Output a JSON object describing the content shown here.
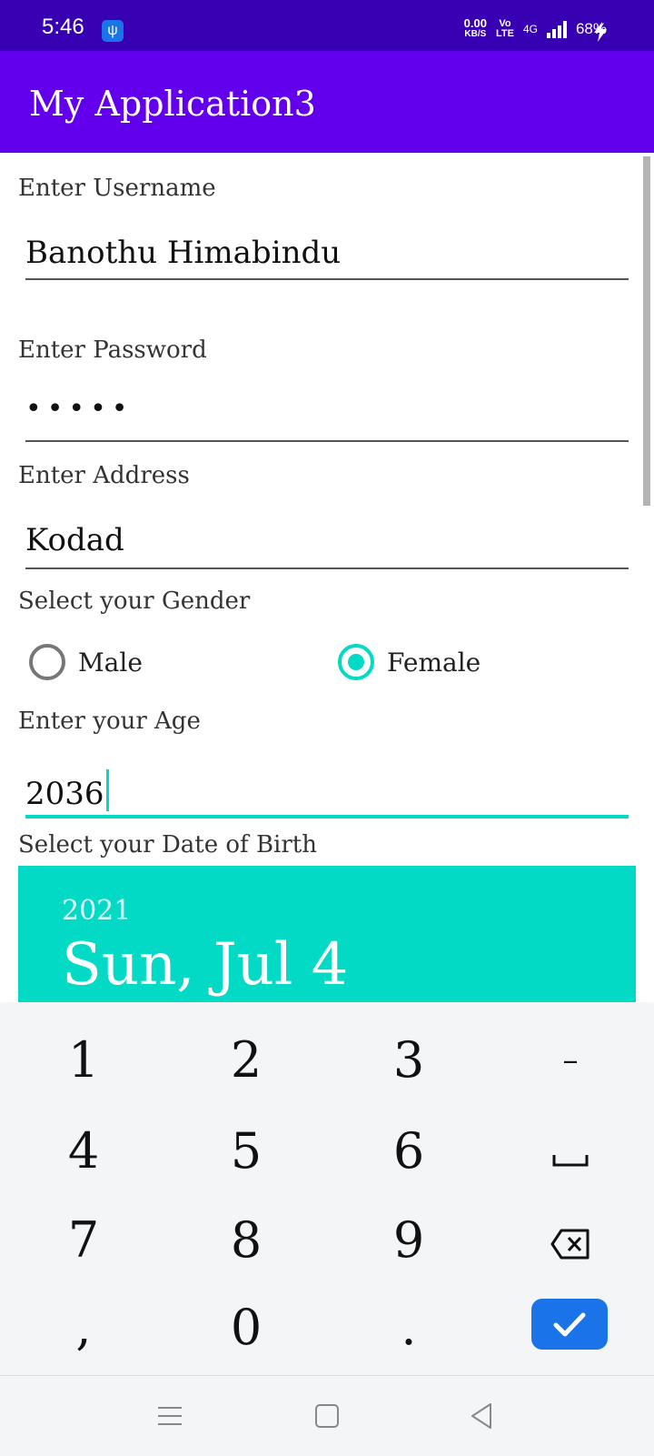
{
  "status_bar": {
    "time": "5:46",
    "speed_value": "0.00",
    "speed_unit": "KB/S",
    "volte_top": "Vo",
    "volte_bottom": "LTE",
    "network": "4G",
    "battery": "68%",
    "icons": [
      "usb-icon",
      "signal-icon",
      "charging-bolt-icon"
    ]
  },
  "app_bar": {
    "title": "My Application3"
  },
  "form": {
    "username_label": "Enter Username",
    "username_value": "Banothu Himabindu",
    "password_label": "Enter Password",
    "password_value": "•••••",
    "address_label": "Enter Address",
    "address_value": "Kodad",
    "gender_label": "Select your Gender",
    "gender_options": [
      {
        "label": "Male",
        "checked": false
      },
      {
        "label": "Female",
        "checked": true
      }
    ],
    "age_label": "Enter your Age",
    "age_value": "2036",
    "dob_label": "Select your Date of Birth"
  },
  "date_picker": {
    "year": "2021",
    "date": "Sun, Jul 4",
    "color": "#03dac5"
  },
  "keyboard": {
    "rows": [
      [
        "1",
        "2",
        "3",
        "–"
      ],
      [
        "4",
        "5",
        "6",
        "␣"
      ],
      [
        "7",
        "8",
        "9",
        "⌫"
      ],
      [
        ",",
        "0",
        ".",
        "✓"
      ]
    ],
    "accent": "#1a73e8"
  },
  "nav_bar": {
    "icons": [
      "menu-icon",
      "home-square-icon",
      "back-triangle-icon"
    ]
  },
  "colors": {
    "status_bar": "#3700b3",
    "app_bar": "#6200ee",
    "accent": "#03dac5"
  }
}
